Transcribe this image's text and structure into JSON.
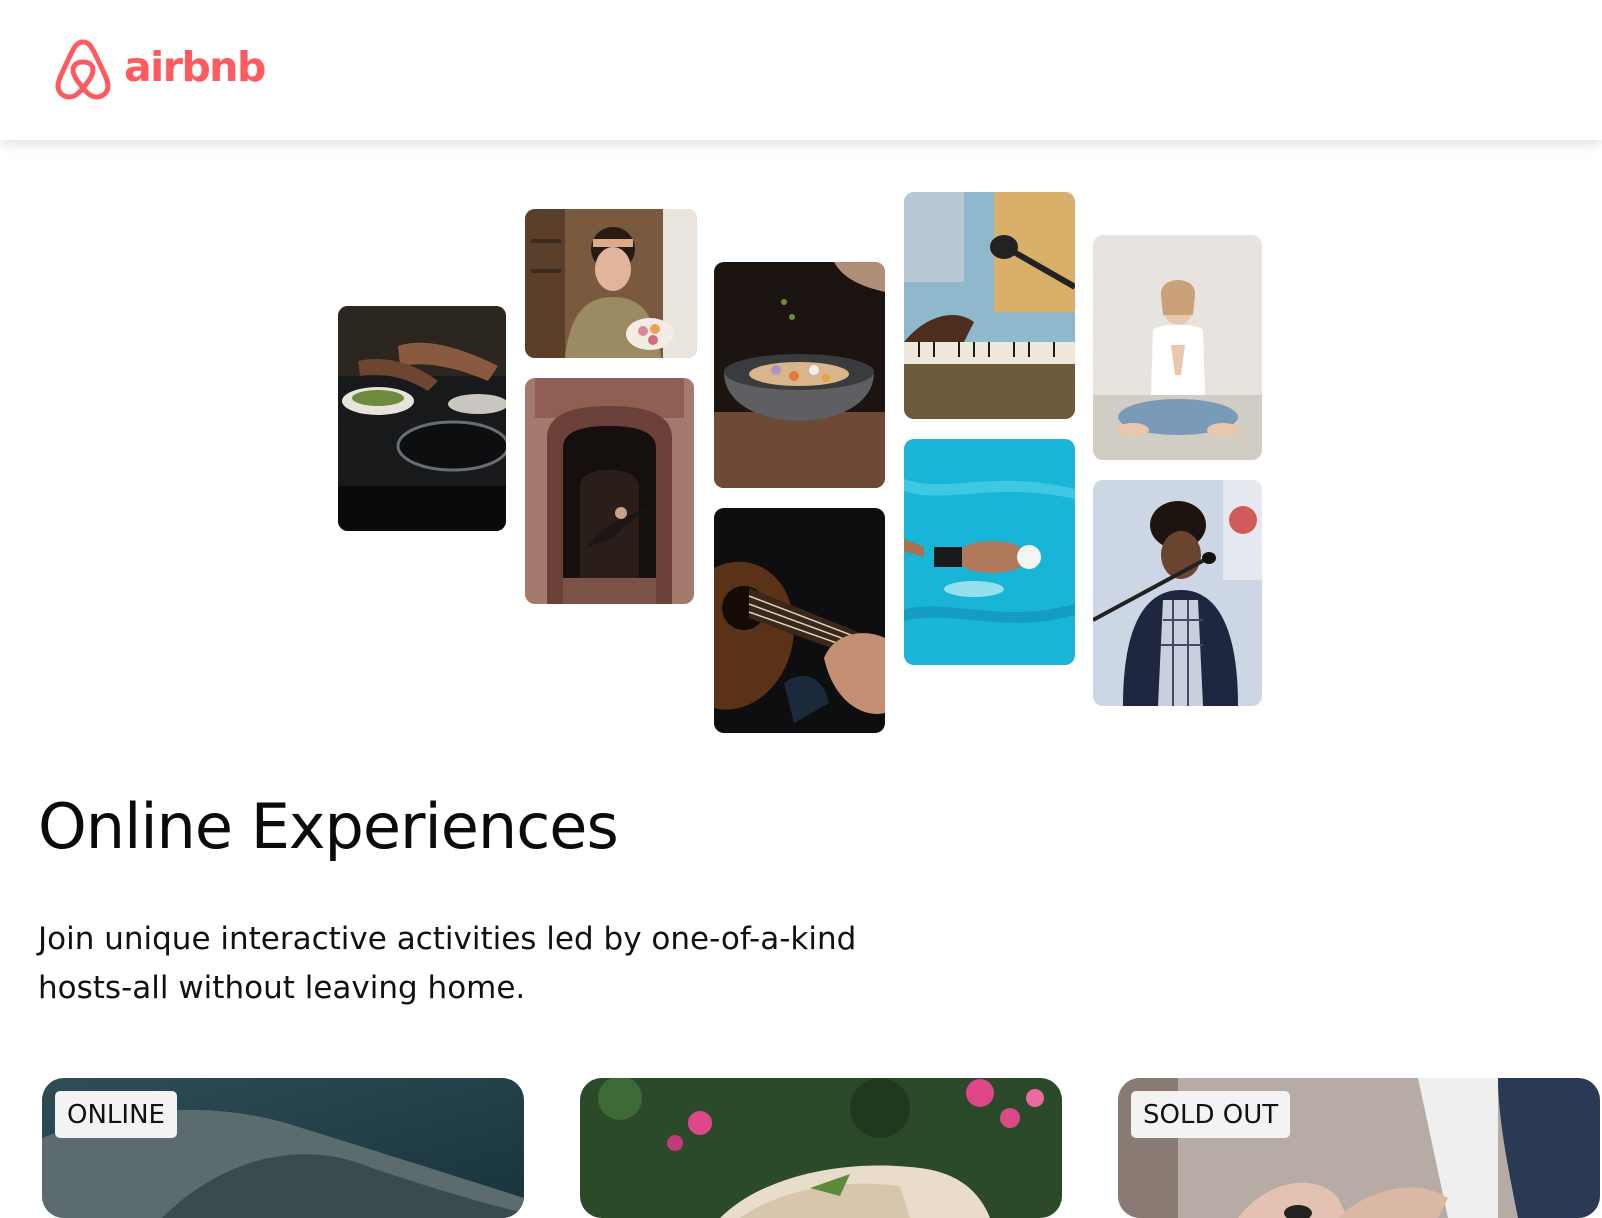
{
  "brand": {
    "name": "airbnb",
    "color": "#FF5A5F",
    "icon": "airbnb-belo-icon"
  },
  "hero": {
    "title": "Online Experiences",
    "subtitle": "Join unique interactive activities led by one-of-a-kind hosts-all without leaving home."
  },
  "photo_grid": [
    {
      "subject": "cooking-pans"
    },
    {
      "subject": "woman-with-macarons"
    },
    {
      "subject": "dancer-in-doorway"
    },
    {
      "subject": "seasoning-bowl"
    },
    {
      "subject": "acoustic-guitar"
    },
    {
      "subject": "piano-and-microphone"
    },
    {
      "subject": "swimmer-in-pool"
    },
    {
      "subject": "meditation-yoga"
    },
    {
      "subject": "singer-with-microphone"
    }
  ],
  "cards": [
    {
      "badge": "ONLINE"
    },
    {
      "badge": ""
    },
    {
      "badge": "SOLD OUT"
    }
  ]
}
